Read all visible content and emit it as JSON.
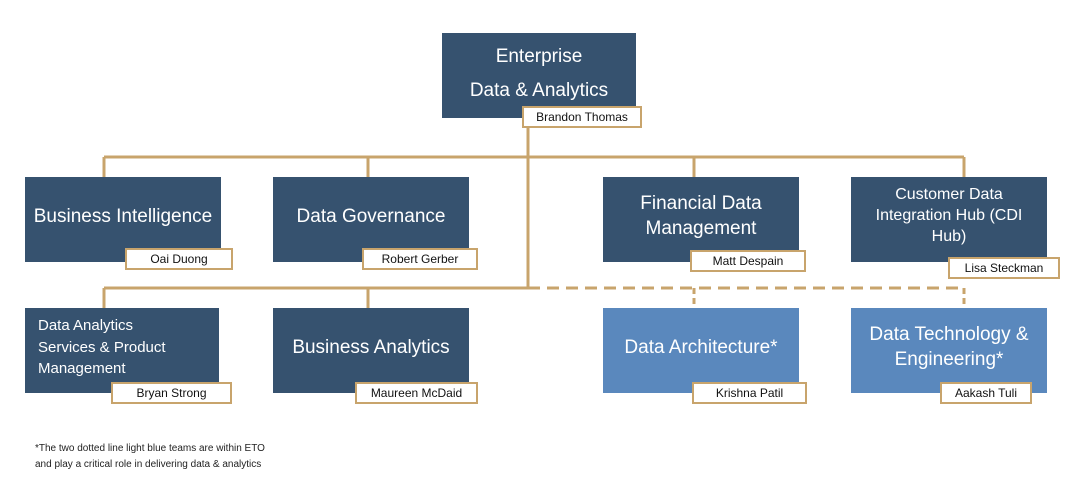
{
  "root": {
    "title": "Enterprise\nData & Analytics",
    "lead": "Brandon Thomas"
  },
  "row1": [
    {
      "title": "Business Intelligence",
      "lead": "Oai Duong"
    },
    {
      "title": "Data Governance",
      "lead": "Robert Gerber"
    },
    {
      "title": "Financial Data\nManagement",
      "lead": "Matt Despain"
    },
    {
      "title": "Customer Data\nIntegration Hub   (CDI\nHub)",
      "lead": "Lisa Steckman"
    }
  ],
  "row2": [
    {
      "title": "Data Analytics\nServices & Product\nManagement",
      "lead": "Bryan Strong"
    },
    {
      "title": "Business Analytics",
      "lead": "Maureen McDaid"
    },
    {
      "title": "Data Architecture*",
      "lead": "Krishna Patil"
    },
    {
      "title": "Data Technology &\nEngineering*",
      "lead": "Aakash Tuli"
    }
  ],
  "footnote": "*The two dotted line light blue teams are within ETO\nand play a critical role in delivering data & analytics",
  "colors": {
    "dark_box": "#36526f",
    "light_box": "#5a88bd",
    "connector": "#c8a46c"
  }
}
